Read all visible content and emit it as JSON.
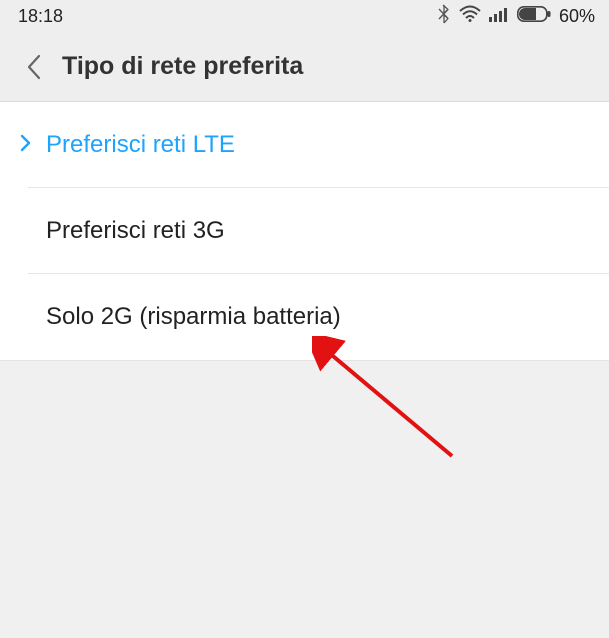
{
  "status_bar": {
    "time": "18:18",
    "battery_percent": "60%"
  },
  "header": {
    "title": "Tipo di rete preferita"
  },
  "options": [
    {
      "label": "Preferisci reti LTE",
      "selected": true
    },
    {
      "label": "Preferisci reti 3G",
      "selected": false
    },
    {
      "label": "Solo 2G (risparmia batteria)",
      "selected": false
    }
  ],
  "colors": {
    "accent": "#1ea3ff",
    "header_bg": "#eeeeee",
    "body_bg": "#f0f0f0",
    "list_bg": "#ffffff",
    "divider": "#e6e6e6",
    "arrow": "#e21212"
  }
}
